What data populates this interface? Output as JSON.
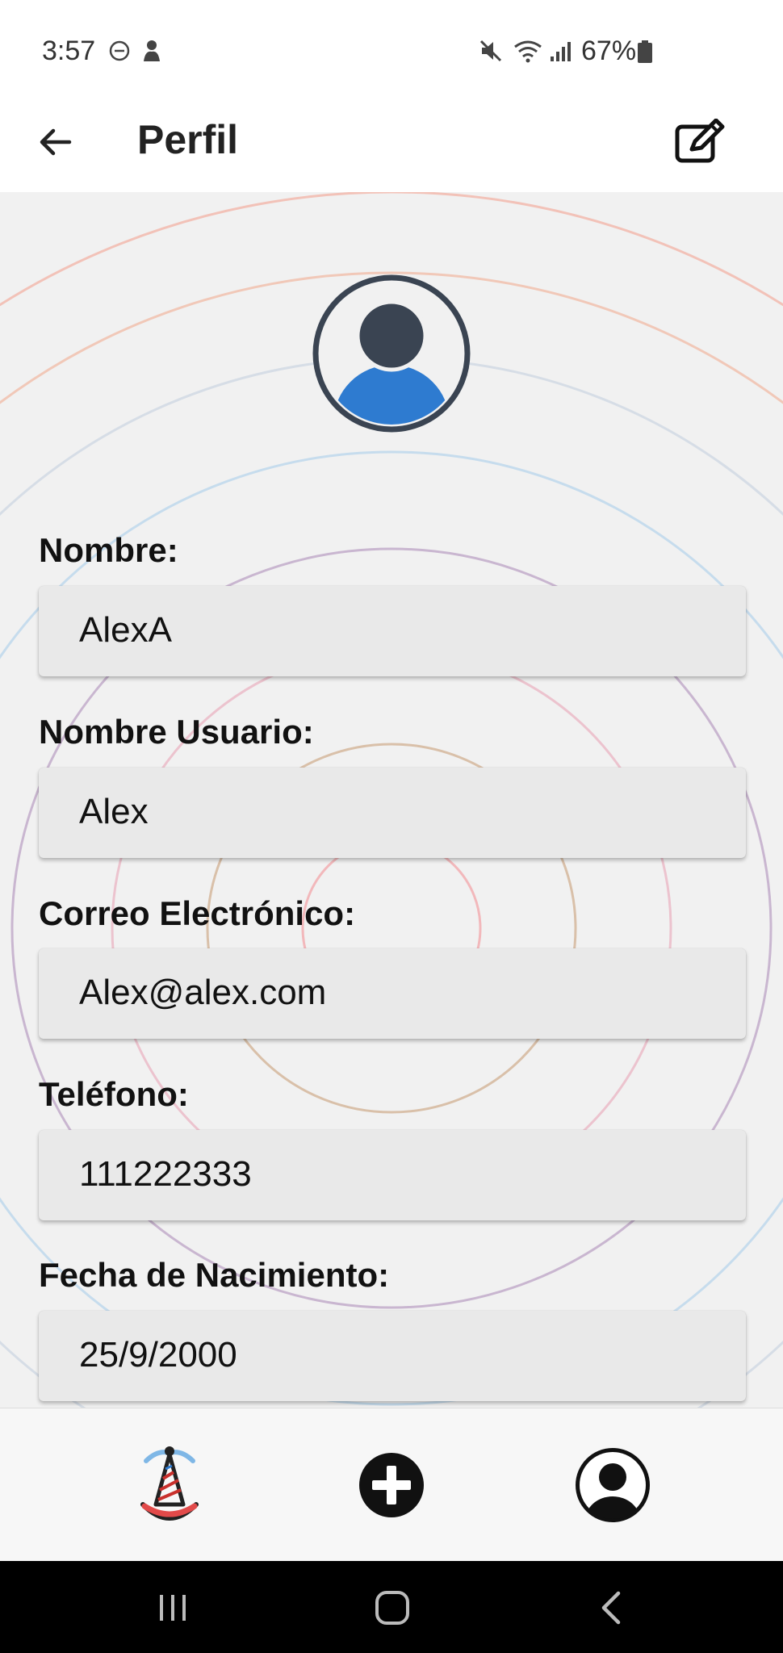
{
  "status_bar": {
    "time": "3:57",
    "battery": "67%",
    "icons": [
      "do-not-disturb-icon",
      "notification-icon",
      "mute-icon",
      "wifi-icon",
      "signal-icon",
      "battery-icon"
    ]
  },
  "app_bar": {
    "title": "Perfil",
    "back_icon": "arrow-left-icon",
    "edit_icon": "edit-icon"
  },
  "profile": {
    "avatar_icon": "user-avatar-icon",
    "fields": [
      {
        "label": "Nombre:",
        "value": "AlexA"
      },
      {
        "label": "Nombre Usuario:",
        "value": "Alex"
      },
      {
        "label": "Correo Electrónico:",
        "value": "Alex@alex.com"
      },
      {
        "label": "Teléfono:",
        "value": "111222333"
      },
      {
        "label": "Fecha de Nacimiento:",
        "value": "25/9/2000"
      }
    ]
  },
  "bottom_nav": {
    "items": [
      "party-hat-icon",
      "add-circle-icon",
      "user-circle-icon"
    ]
  },
  "system_nav": {
    "items": [
      "recents-icon",
      "home-icon",
      "back-icon"
    ]
  },
  "colors": {
    "avatar_body": "#2e7bd0",
    "avatar_dark": "#3a4452",
    "field_bg": "#e9e9e9"
  }
}
